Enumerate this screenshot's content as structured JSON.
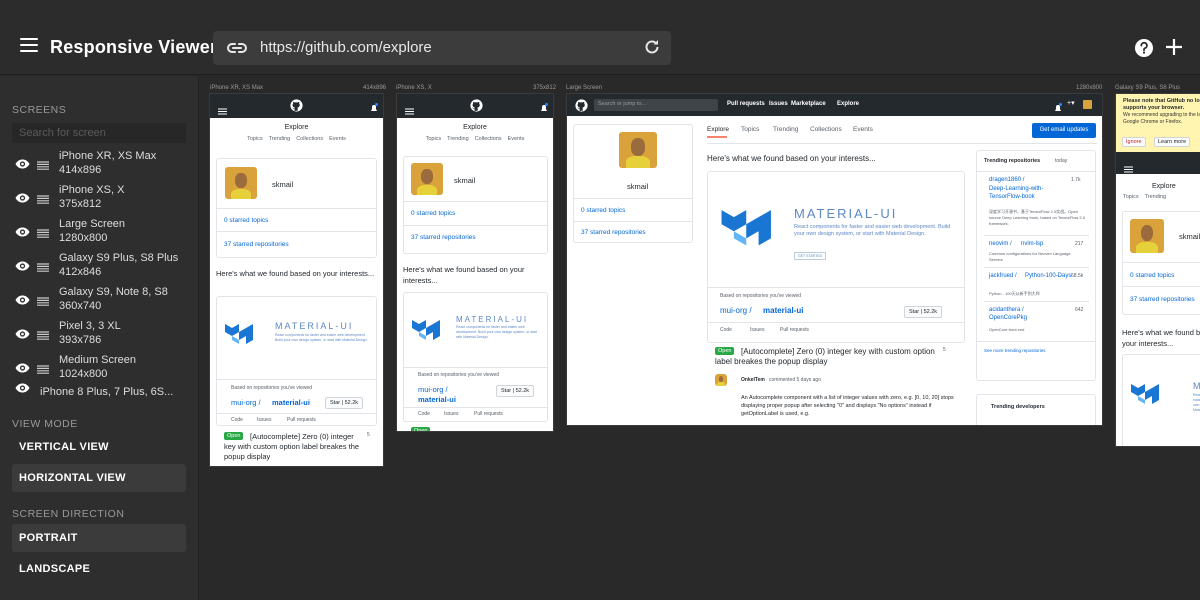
{
  "app": {
    "title": "Responsive Viewer",
    "url": "https://github.com/explore"
  },
  "sidebar": {
    "screens_heading": "SCREENS",
    "search_placeholder": "Search for screen",
    "screens": [
      {
        "name": "iPhone XR, XS Max",
        "size": "414x896"
      },
      {
        "name": "iPhone XS, X",
        "size": "375x812"
      },
      {
        "name": "Large Screen",
        "size": "1280x800"
      },
      {
        "name": "Galaxy S9 Plus, S8 Plus",
        "size": "412x846"
      },
      {
        "name": "Galaxy S9, Note 8, S8",
        "size": "360x740"
      },
      {
        "name": "Pixel 3, 3 XL",
        "size": "393x786"
      },
      {
        "name": "Medium Screen",
        "size": "1024x800"
      },
      {
        "name": "iPhone 8 Plus, 7 Plus, 6S...",
        "size": ""
      }
    ],
    "view_mode_heading": "VIEW MODE",
    "view_modes": [
      "VERTICAL VIEW",
      "HORIZONTAL VIEW"
    ],
    "view_mode_selected": "HORIZONTAL VIEW",
    "direction_heading": "SCREEN DIRECTION",
    "directions": [
      "PORTRAIT",
      "LANDSCAPE"
    ],
    "direction_selected": "PORTRAIT"
  },
  "frames": [
    {
      "label": "iPhone XR, XS Max",
      "size": "414x896"
    },
    {
      "label": "iPhone XS, X",
      "size": "375x812"
    },
    {
      "label": "Large Screen",
      "size": "1280x800"
    },
    {
      "label": "Galaxy S9 Plus, S8 Plus",
      "size": ""
    }
  ],
  "github": {
    "explore": "Explore",
    "tabs": [
      "Topics",
      "Trending",
      "Collections",
      "Events"
    ],
    "username": "skmail",
    "starred_topics": "0 starred topics",
    "starred_repos": "37 starred repositories",
    "found_interests": "Here's what we found based on your interests...",
    "mui_word": "MATERIAL-UI",
    "mui_desc": "React components for faster and easier web development. Build your own design system, or start with Material Design.",
    "get_started": "GET STARTED",
    "based_on": "Based on repositories you've viewed",
    "repo_owner": "mui-org /",
    "repo_name": "material-ui",
    "star": "Star",
    "star_count": "52.2k",
    "code_tab": "Code",
    "issues_tab": "Issues",
    "pulls_tab": "Pull requests",
    "open_badge": "Open",
    "issue_title": "[Autocomplete] Zero (0) integer key with custom option label breakes the popup display",
    "issue_comments": "5",
    "search_placeholder": "Search or jump to...",
    "top_nav": [
      "Pull requests",
      "Issues",
      "Marketplace",
      "Explore"
    ],
    "email_button": "Get email updates",
    "trending_repos_title": "Trending repositories",
    "trending_today": "today",
    "trending": [
      {
        "owner": "dragen1860 /",
        "name": "Deep-Learning-with-TensorFlow-book",
        "desc": "深度学习开源书，基于TensorFlow 2.0实战。Open source Deep Learning book, based on TensorFlow 2.0 framework.",
        "stars": "1.7k"
      },
      {
        "owner": "neovim /",
        "name": "nvim-lsp",
        "desc": "Common configurations for Neovim Language Servers",
        "stars": "217"
      },
      {
        "owner": "jackfrued /",
        "name": "Python-100-Days",
        "desc": "Python - 100天从新手到大师",
        "stars": "68.5k"
      },
      {
        "owner": "acidanthera /",
        "name": "OpenCorePkg",
        "desc": "OpenCore front end",
        "stars": "642"
      }
    ],
    "see_more_trending": "See more trending repositories",
    "trending_devs_title": "Trending developers",
    "commenter": "OnkelTem",
    "commented_when": "commented 5 days ago",
    "comment_text": "An Autocomplete component with a list of integer values with zero, e.g. [0, 10, 20] stops displaying proper popup after selecting \"0\" and displays \"No options\" instead if getOptionLabel is used, e.g.",
    "banner_text": "Please note that GitHub no longer supports your browser.",
    "banner_sub": "We recommend upgrading to the latest Google Chrome or Firefox.",
    "ignore": "Ignore",
    "learn_more": "Learn more"
  }
}
